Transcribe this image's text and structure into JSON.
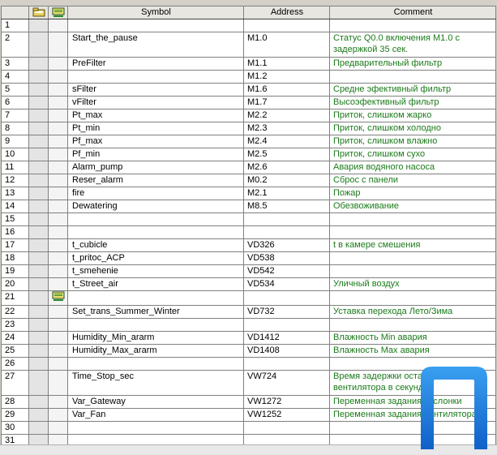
{
  "header": {
    "symbol": "Symbol",
    "address": "Address",
    "comment": "Comment",
    "icon1": "folder-symbol-icon",
    "icon2": "pou-symbol-icon"
  },
  "rows": [
    {
      "n": "1",
      "sym": "",
      "addr": "",
      "cmt": "",
      "icon": false,
      "tall": false
    },
    {
      "n": "2",
      "sym": "Start_the_pause",
      "addr": "M1.0",
      "cmt": "Статус Q0.0 включения M1.0 с задержкой 35 сек.",
      "icon": false,
      "tall": true
    },
    {
      "n": "3",
      "sym": "PreFilter",
      "addr": "M1.1",
      "cmt": "Предварительный фильтр",
      "icon": false,
      "tall": false
    },
    {
      "n": "4",
      "sym": "",
      "addr": "M1.2",
      "cmt": "",
      "icon": false,
      "tall": false
    },
    {
      "n": "5",
      "sym": "sFilter",
      "addr": "M1.6",
      "cmt": "Средне эфективный фильтр",
      "icon": false,
      "tall": false
    },
    {
      "n": "6",
      "sym": "vFilter",
      "addr": "M1.7",
      "cmt": "Высоэфективный  фильтр",
      "icon": false,
      "tall": false
    },
    {
      "n": "7",
      "sym": "Pt_max",
      "addr": "M2.2",
      "cmt": "Приток, слишком жарко",
      "icon": false,
      "tall": false
    },
    {
      "n": "8",
      "sym": "Pt_min",
      "addr": "M2.3",
      "cmt": "Приток, слишком холодно",
      "icon": false,
      "tall": false
    },
    {
      "n": "9",
      "sym": "Pf_max",
      "addr": "M2.4",
      "cmt": "Приток, слишком влажно",
      "icon": false,
      "tall": false
    },
    {
      "n": "10",
      "sym": "Pf_min",
      "addr": "M2.5",
      "cmt": "Приток, слишком сухо",
      "icon": false,
      "tall": false
    },
    {
      "n": "11",
      "sym": "Alarm_pump",
      "addr": "M2.6",
      "cmt": "Авария водяного насоса",
      "icon": false,
      "tall": false
    },
    {
      "n": "12",
      "sym": "Reser_alarm",
      "addr": "M0.2",
      "cmt": "Сброс с панели",
      "icon": false,
      "tall": false
    },
    {
      "n": "13",
      "sym": "fire",
      "addr": "M2.1",
      "cmt": "Пожар",
      "icon": false,
      "tall": false
    },
    {
      "n": "14",
      "sym": "Dewatering",
      "addr": "M8.5",
      "cmt": "Обезвоживание",
      "icon": false,
      "tall": false
    },
    {
      "n": "15",
      "sym": "",
      "addr": "",
      "cmt": "",
      "icon": false,
      "tall": false
    },
    {
      "n": "16",
      "sym": "",
      "addr": "",
      "cmt": "",
      "icon": false,
      "tall": false
    },
    {
      "n": "17",
      "sym": "t_cubicle",
      "addr": "VD326",
      "cmt": "t в камере смешения",
      "icon": false,
      "tall": false
    },
    {
      "n": "18",
      "sym": "t_pritoc_ACP",
      "addr": "VD538",
      "cmt": "",
      "icon": false,
      "tall": false
    },
    {
      "n": "19",
      "sym": "t_smehenie",
      "addr": "VD542",
      "cmt": "",
      "icon": false,
      "tall": false
    },
    {
      "n": "20",
      "sym": "t_Street_air",
      "addr": "VD534",
      "cmt": "Уличный воздух",
      "icon": false,
      "tall": false
    },
    {
      "n": "21",
      "sym": "",
      "addr": "",
      "cmt": "",
      "icon": true,
      "tall": false
    },
    {
      "n": "22",
      "sym": "Set_trans_Summer_Winter",
      "addr": "VD732",
      "cmt": "Уставка перехода Лето/Зима",
      "icon": false,
      "tall": false
    },
    {
      "n": "23",
      "sym": "",
      "addr": "",
      "cmt": "",
      "icon": false,
      "tall": false
    },
    {
      "n": "24",
      "sym": "Humidity_Min_ararm",
      "addr": "VD1412",
      "cmt": "Влажность Min авария",
      "icon": false,
      "tall": false
    },
    {
      "n": "25",
      "sym": "Humidity_Max_ararm",
      "addr": "VD1408",
      "cmt": "Влажность Max авария",
      "icon": false,
      "tall": false
    },
    {
      "n": "26",
      "sym": "",
      "addr": "",
      "cmt": "",
      "icon": false,
      "tall": false
    },
    {
      "n": "27",
      "sym": "Time_Stop_sec",
      "addr": "VW724",
      "cmt": "Время задержки остановки вентилятора в секундах",
      "icon": false,
      "tall": true
    },
    {
      "n": "28",
      "sym": "Var_Gateway",
      "addr": "VW1272",
      "cmt": "Переменная задания заслонки",
      "icon": false,
      "tall": false
    },
    {
      "n": "29",
      "sym": "Var_Fan",
      "addr": "VW1252",
      "cmt": "Переменная задания вентилятора",
      "icon": false,
      "tall": false
    },
    {
      "n": "30",
      "sym": "",
      "addr": "",
      "cmt": "",
      "icon": false,
      "tall": false
    },
    {
      "n": "31",
      "sym": "",
      "addr": "",
      "cmt": "",
      "icon": false,
      "tall": false
    }
  ],
  "colors": {
    "comment": "#1a7a1a",
    "logo": "#1e73d6"
  },
  "logo_icon": "brand-logo-icon"
}
